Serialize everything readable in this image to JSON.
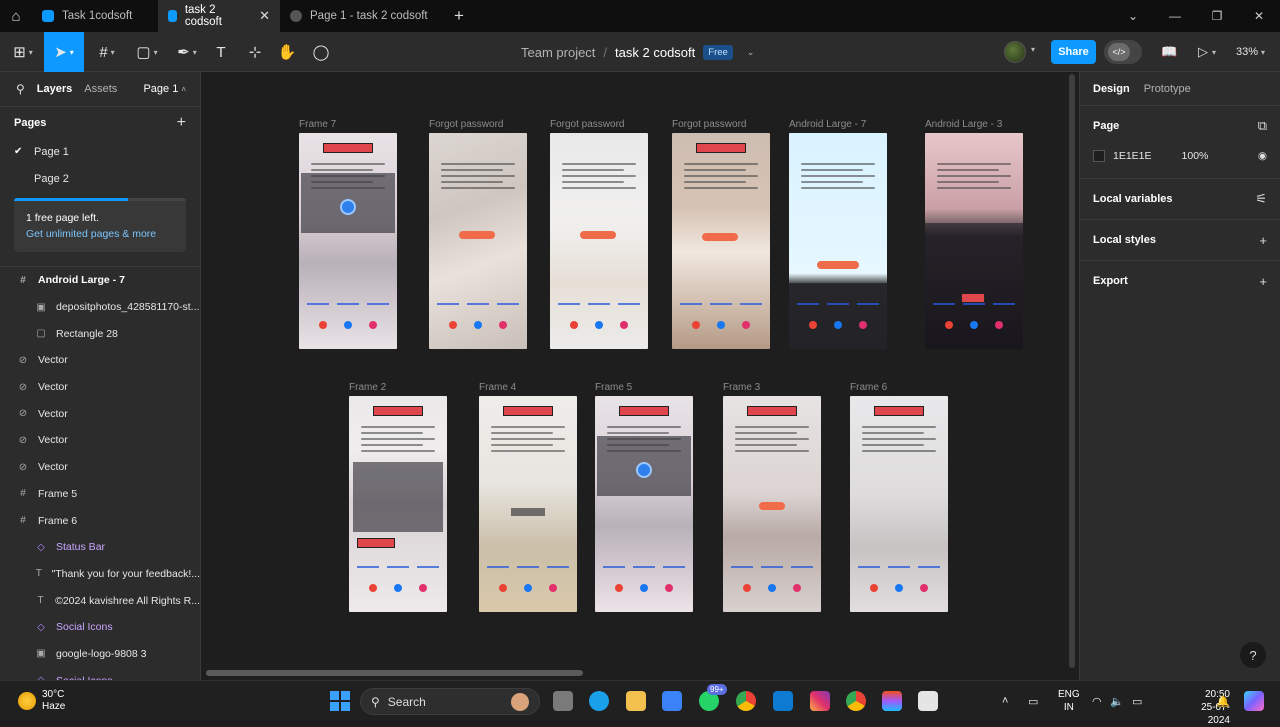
{
  "window_tabs": [
    {
      "label": "Task 1codsoft",
      "active": false,
      "icon_color": "#0d99ff"
    },
    {
      "label": "task 2 codsoft",
      "active": true,
      "icon_color": "#0d99ff"
    },
    {
      "label": "Page 1 - task 2 codsoft",
      "active": false,
      "icon_color": "#777777"
    }
  ],
  "toolbar": {
    "project": "Team project",
    "separator": "/",
    "file": "task 2 codsoft",
    "plan_badge": "Free",
    "share_label": "Share",
    "zoom": "33%"
  },
  "left_panel": {
    "tab_layers": "Layers",
    "tab_assets": "Assets",
    "current_page": "Page 1",
    "pages_heading": "Pages",
    "pages": [
      "Page 1",
      "Page 2"
    ],
    "promo_title": "1 free page left.",
    "promo_link": "Get unlimited pages & more",
    "promo_progress": 0.66,
    "layers": [
      {
        "label": "Android Large - 7",
        "icon": "frame-icon",
        "glyph": "#",
        "indent": 0,
        "style": "bold"
      },
      {
        "label": "depositphotos_428581170-st...",
        "icon": "image-icon",
        "glyph": "▣",
        "indent": 1,
        "style": "normal"
      },
      {
        "label": "Rectangle 28",
        "icon": "rectangle-icon",
        "glyph": "▢",
        "indent": 1,
        "style": "normal"
      },
      {
        "label": "Vector",
        "icon": "vector-icon",
        "glyph": "⊘",
        "indent": 0,
        "style": "normal"
      },
      {
        "label": "Vector",
        "icon": "vector-icon",
        "glyph": "⊘",
        "indent": 0,
        "style": "normal"
      },
      {
        "label": "Vector",
        "icon": "vector-icon",
        "glyph": "⊘",
        "indent": 0,
        "style": "normal"
      },
      {
        "label": "Vector",
        "icon": "vector-icon",
        "glyph": "⊘",
        "indent": 0,
        "style": "normal"
      },
      {
        "label": "Vector",
        "icon": "vector-icon",
        "glyph": "⊘",
        "indent": 0,
        "style": "normal"
      },
      {
        "label": "Frame 5",
        "icon": "frame-icon",
        "glyph": "#",
        "indent": 0,
        "style": "normal"
      },
      {
        "label": "Frame 6",
        "icon": "frame-icon",
        "glyph": "#",
        "indent": 0,
        "style": "normal"
      },
      {
        "label": "Status Bar",
        "icon": "component-icon",
        "glyph": "◇",
        "indent": 1,
        "style": "comp"
      },
      {
        "label": "\"Thank you for your feedback!...",
        "icon": "text-icon",
        "glyph": "T",
        "indent": 1,
        "style": "normal"
      },
      {
        "label": "©2024 kavishree All Rights R...",
        "icon": "text-icon",
        "glyph": "T",
        "indent": 1,
        "style": "normal"
      },
      {
        "label": "Social Icons",
        "icon": "component-icon",
        "glyph": "◇",
        "indent": 1,
        "style": "comp"
      },
      {
        "label": "google-logo-9808 3",
        "icon": "image-icon",
        "glyph": "▣",
        "indent": 1,
        "style": "normal"
      },
      {
        "label": "Social Icons",
        "icon": "component-icon",
        "glyph": "◇",
        "indent": 1,
        "style": "comp"
      }
    ]
  },
  "frames_row1": [
    {
      "label": "Frame 7",
      "bg": "linear-gradient(180deg,#e8e3e6 0%,#d9cfd4 40%,#b9b1b8 60%,#e9e2e6 100%)",
      "variant": "verified"
    },
    {
      "label": "Forgot password",
      "bg": "linear-gradient(160deg,#dcd6d2 0%,#cfc6bf 35%,#e9e1da 60%,#c9bfb8 100%)",
      "variant": "form"
    },
    {
      "label": "Forgot password",
      "bg": "linear-gradient(180deg,#e9e9ea 0%,#f1f0ef 40%,#e6dfd6 70%,#ecebea 100%)",
      "variant": "code"
    },
    {
      "label": "Forgot password",
      "bg": "linear-gradient(180deg,#cdbdb1 0%,#d7c3b4 35%,#f0e7df 55%,#b59a86 100%)",
      "variant": "email"
    },
    {
      "label": "Android Large - 7",
      "bg": "linear-gradient(180deg,#d9f3ff 0%,#e6f7ff 65%,#3d3d3d 70%,#333 100%)",
      "variant": "illustration"
    },
    {
      "label": "Android Large - 3",
      "bg": "linear-gradient(180deg,#e7c7c9 0%,#caa0a6 35%,#3a3436 48%,#1f1a1c 100%)",
      "variant": "login"
    }
  ],
  "frames_row2": [
    {
      "label": "Frame 2",
      "bg": "linear-gradient(180deg,#ebe8ea 0%,#efeded 25%,#d8d2d4 50%,#eeeaeb 100%)",
      "variant": "cart"
    },
    {
      "label": "Frame 4",
      "bg": "linear-gradient(180deg,#efedea 0%,#e8e5e0 40%,#cbbfa9 70%,#d9c9aa 100%)",
      "variant": "email_verify"
    },
    {
      "label": "Frame 5",
      "bg": "linear-gradient(180deg,#e8e3e6 0%,#d8d0d6 40%,#b9b1b8 60%,#ebe3e7 100%)",
      "variant": "verified"
    },
    {
      "label": "Frame 3",
      "bg": "linear-gradient(180deg,#e6e3e3 0%,#dcd4d2 45%,#b8aaa5 65%,#d9d1cf 100%)",
      "variant": "thanks"
    },
    {
      "label": "Frame 6",
      "bg": "linear-gradient(180deg,#e9e8ea 0%,#dedcdd 45%,#c7c3c3 70%,#e2dedf 100%)",
      "variant": "feedback"
    }
  ],
  "right_panel": {
    "tab_design": "Design",
    "tab_prototype": "Prototype",
    "page_heading": "Page",
    "page_color_hex": "1E1E1E",
    "page_color": "#1E1E1E",
    "page_opacity": "100%",
    "local_variables": "Local variables",
    "local_styles": "Local styles",
    "export": "Export"
  },
  "taskbar": {
    "temperature": "30°C",
    "weather": "Haze",
    "search_placeholder": "Search",
    "badge": "99+",
    "lang_line1": "ENG",
    "lang_line2": "IN",
    "time": "20:50",
    "date": "25-07-2024"
  },
  "colors": {
    "accent": "#0d99ff",
    "canvas": "#1e1e1e",
    "panel": "#2c2c2c"
  }
}
